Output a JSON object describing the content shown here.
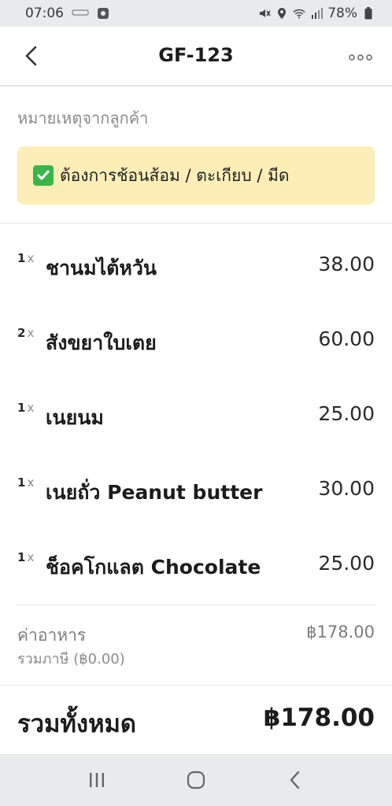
{
  "status_bar": {
    "time": "07:06",
    "small_icon_text": "LINE\nMAN",
    "battery": "78%",
    "icons": [
      "mute-icon",
      "location-icon",
      "wifi-icon",
      "signal-icon",
      "battery-icon"
    ]
  },
  "header": {
    "title": "GF-123",
    "back_icon": "chevron-left-icon",
    "more_icon": "more-horizontal-icon"
  },
  "note": {
    "label": "หมายเหตุจากลูกค้า",
    "text": "ต้องการช้อนส้อม / ตะเกียบ / มีด",
    "icon": "check-box-icon"
  },
  "items": [
    {
      "qty": "1",
      "x": "x",
      "name": "ชานมไต้หวัน",
      "price": "38.00"
    },
    {
      "qty": "2",
      "x": "x",
      "name": "สังขยาใบเตย",
      "price": "60.00"
    },
    {
      "qty": "1",
      "x": "x",
      "name": "เนยนม",
      "price": "25.00"
    },
    {
      "qty": "1",
      "x": "x",
      "name": "เนยถั่ว Peanut butter",
      "price": "30.00"
    },
    {
      "qty": "1",
      "x": "x",
      "name": "ช็อคโกแลต Chocolate",
      "price": "25.00"
    }
  ],
  "summary": {
    "food_label": "ค่าอาหาร",
    "food_amount": "฿178.00",
    "tax_label": "รวมภาษี (฿0.00)"
  },
  "total": {
    "label": "รวมทั้งหมด",
    "amount": "฿178.00"
  },
  "colors": {
    "note_bg": "#fdeeb8",
    "check_green": "#3bb54a",
    "system_bar": "#e9eaec"
  }
}
